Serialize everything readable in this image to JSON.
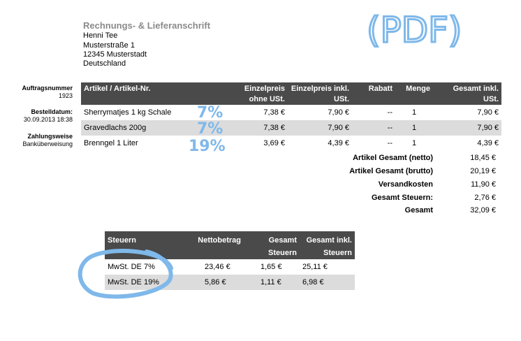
{
  "address": {
    "title": "Rechnungs- & Lieferanschrift",
    "name": "Henni Tee",
    "street": "Musterstraße 1",
    "city": "12345 Musterstadt",
    "country": "Deutschland"
  },
  "meta": {
    "order_label": "Auftragsnummer",
    "order_value": "1923",
    "date_label": "Bestelldatum:",
    "date_value": "30.09.2013 18:38",
    "payment_label": "Zahlungsweise",
    "payment_value": "Banküberweisung"
  },
  "items_table": {
    "headers": {
      "article": "Artikel / Artikel-Nr.",
      "unit_net_1": "Einzelpreis",
      "unit_net_2": "ohne USt.",
      "unit_gross_1": "Einzelpreis inkl.",
      "unit_gross_2": "USt.",
      "discount": "Rabatt",
      "qty": "Menge",
      "total_1": "Gesamt inkl.",
      "total_2": "USt."
    },
    "rows": [
      {
        "article": "Sherrymatjes 1 kg Schale",
        "unit_net": "7,38 €",
        "unit_gross": "7,90 €",
        "discount": "--",
        "qty": "1",
        "total": "7,90 €"
      },
      {
        "article": "Gravedlachs 200g",
        "unit_net": "7,38 €",
        "unit_gross": "7,90 €",
        "discount": "--",
        "qty": "1",
        "total": "7,90 €"
      },
      {
        "article": "Brenngel 1 Liter",
        "unit_net": "3,69 €",
        "unit_gross": "4,39 €",
        "discount": "--",
        "qty": "1",
        "total": "4,39 €"
      }
    ]
  },
  "totals": [
    {
      "label": "Artikel Gesamt (netto)",
      "value": "18,45 €"
    },
    {
      "label": "Artikel Gesamt (brutto)",
      "value": "20,19 €"
    },
    {
      "label": "Versandkosten",
      "value": "11,90 €"
    },
    {
      "label": "Gesamt Steuern:",
      "value": "2,76 €"
    },
    {
      "label": "Gesamt",
      "value": "32,09 €"
    }
  ],
  "tax_table": {
    "headers": {
      "tax": "Steuern",
      "net": "Nettobetrag",
      "tax_total_1": "Gesamt",
      "tax_total_2": "Steuern",
      "gross_1": "Gesamt inkl.",
      "gross_2": "Steuern"
    },
    "rows": [
      {
        "tax": "MwSt. DE 7%",
        "net": "23,46 €",
        "tax_total": "1,65 €",
        "gross": "25,11 €"
      },
      {
        "tax": "MwSt. DE 19%",
        "net": "5,86 €",
        "tax_total": "1,11 €",
        "gross": "6,98 €"
      }
    ]
  },
  "annotations": {
    "pdf_note": "(PDF)",
    "rate_1": "7%",
    "rate_2": "7%",
    "rate_3": "19%",
    "ink_color": "#7fb8ea"
  }
}
